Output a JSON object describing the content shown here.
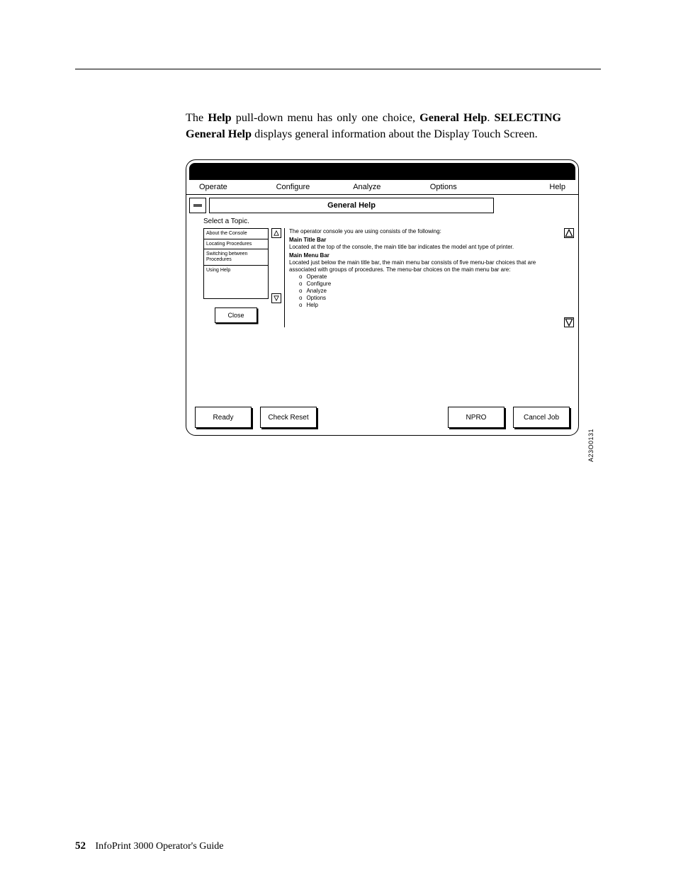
{
  "paragraph": {
    "prefix": "The ",
    "b1": "Help",
    "mid1": " pull-down menu has only one choice, ",
    "b2": "General Help",
    "mid2": ". ",
    "b3": "SELECTING General Help",
    "suffix": " displays general information about the Display Touch Screen."
  },
  "menubar": {
    "operate": "Operate",
    "configure": "Configure",
    "analyze": "Analyze",
    "options": "Options",
    "help": "Help"
  },
  "dialog": {
    "title": "General Help",
    "select_label": "Select a Topic.",
    "topics": [
      "About the Console",
      "Locating Procedures",
      "Switching between Procedures",
      "Using Help"
    ],
    "close": "Close"
  },
  "content": {
    "line1": "The operator console you are using consists of the following:",
    "h1": "Main Title Bar",
    "line2": "Located at the top of the console, the main title bar indicates the model ant type of printer.",
    "h2": "Main Menu Bar",
    "line3": "Located just below the main title bar, the main menu bar consists of five menu-bar choices that are associated with groups of procedures. The menu-bar choices on the main menu bar are:",
    "items": [
      "Operate",
      "Configure",
      "Analyze",
      "Options",
      "Help"
    ]
  },
  "buttons": {
    "ready": "Ready",
    "check": "Check Reset",
    "npro": "NPRO",
    "cancel": "Cancel Job"
  },
  "figure_id": "A23O0131",
  "footer": {
    "page": "52",
    "title": "InfoPrint 3000 Operator's Guide"
  }
}
